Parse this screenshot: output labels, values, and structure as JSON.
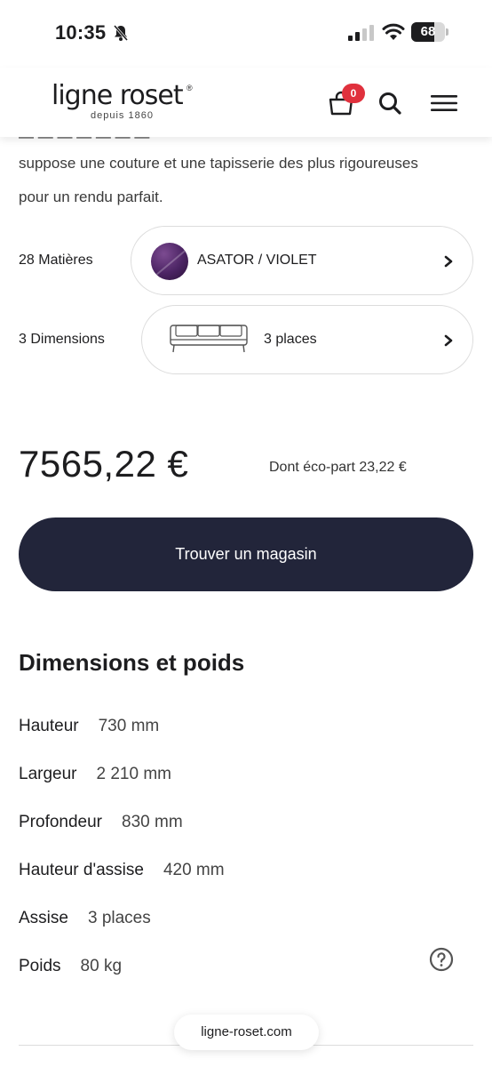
{
  "status_bar": {
    "time": "10:35",
    "battery_level": "68",
    "battery_fraction": 0.68
  },
  "header": {
    "logo_text": "ligne roset",
    "logo_registered": "®",
    "logo_subtitle": "depuis 1860",
    "cart_count": "0",
    "icons": [
      "shopping-bag-icon",
      "search-icon",
      "hamburger-menu-icon"
    ]
  },
  "description": {
    "line_1": "suppose une couture et une tapisserie des plus rigoureuses",
    "line_2": "pour un rendu parfait."
  },
  "options": {
    "materials": {
      "label": "28 Matières",
      "value": "ASATOR / VIOLET",
      "swatch_color": "#4b2463"
    },
    "dimensions": {
      "label": "3 Dimensions",
      "value": "3 places"
    }
  },
  "price": {
    "amount": "7565,22 €",
    "eco_part": "Dont éco-part 23,22 €"
  },
  "actions": {
    "find_store": "Trouver un magasin"
  },
  "specs": {
    "title": "Dimensions et poids",
    "rows": [
      {
        "name": "Hauteur",
        "value": "730 mm"
      },
      {
        "name": "Largeur",
        "value": "2  210 mm"
      },
      {
        "name": "Profondeur",
        "value": "830 mm"
      },
      {
        "name": "Hauteur d'assise",
        "value": "420 mm"
      },
      {
        "name": "Assise",
        "value": "3 places"
      },
      {
        "name": "Poids",
        "value": "80 kg"
      }
    ]
  },
  "footer": {
    "url": "ligne-roset.com"
  },
  "colors": {
    "primary_button": "#22253a",
    "badge": "#e0313d"
  }
}
